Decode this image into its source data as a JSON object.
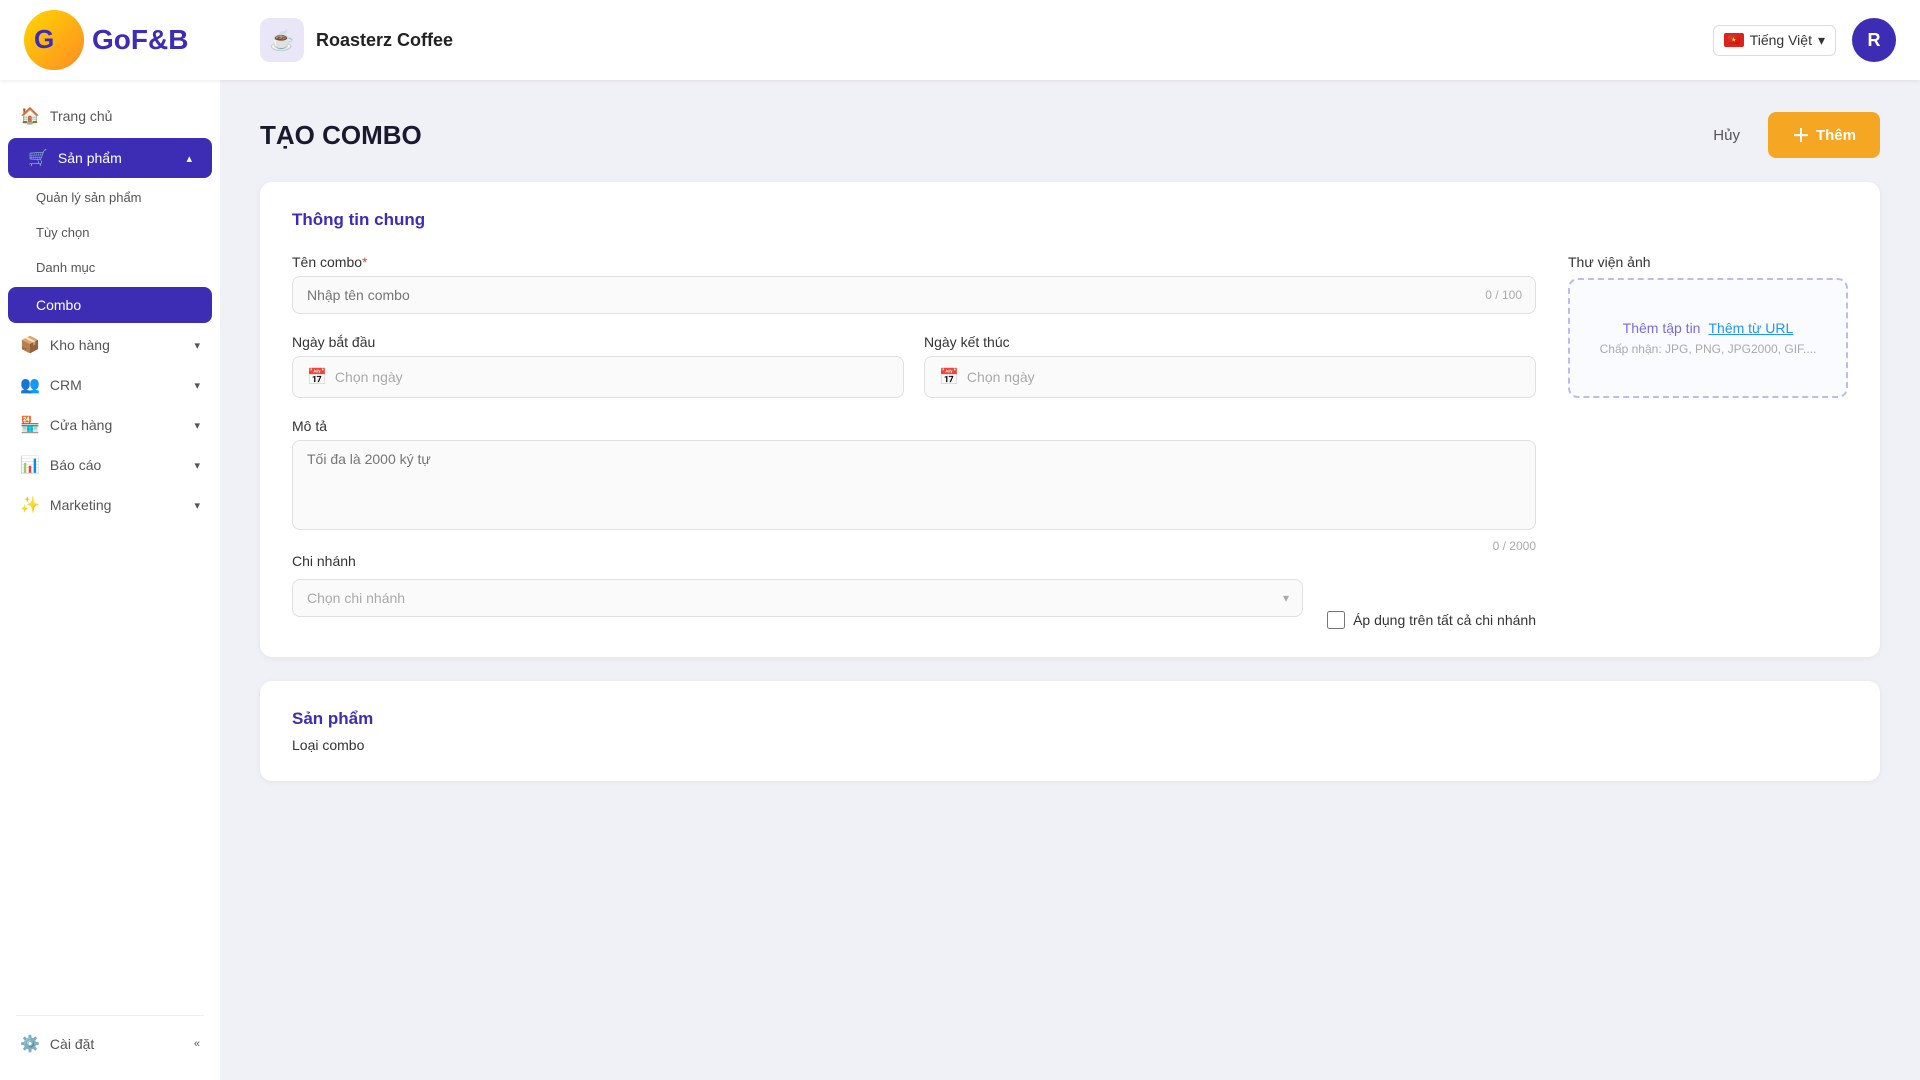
{
  "topbar": {
    "logo_text": "GoF&B",
    "brand_name": "Roasterz Coffee",
    "brand_icon": "☕",
    "lang": "Tiếng Việt",
    "avatar_letter": "R"
  },
  "sidebar": {
    "items": [
      {
        "id": "trang-chu",
        "label": "Trang chủ",
        "icon": "🏠",
        "active": false
      },
      {
        "id": "san-pham",
        "label": "Sản phẩm",
        "icon": "🛒",
        "active": true,
        "expanded": true,
        "children": [
          {
            "id": "quan-ly-san-pham",
            "label": "Quản lý sản phẩm",
            "active": false
          },
          {
            "id": "tuy-chon",
            "label": "Tùy chọn",
            "active": false
          },
          {
            "id": "danh-muc",
            "label": "Danh mục",
            "active": false
          },
          {
            "id": "combo",
            "label": "Combo",
            "active": true
          }
        ]
      },
      {
        "id": "kho-hang",
        "label": "Kho hàng",
        "icon": "📦",
        "active": false
      },
      {
        "id": "crm",
        "label": "CRM",
        "icon": "👥",
        "active": false
      },
      {
        "id": "cua-hang",
        "label": "Cửa hàng",
        "icon": "🏪",
        "active": false
      },
      {
        "id": "bao-cao",
        "label": "Báo cáo",
        "icon": "📊",
        "active": false
      },
      {
        "id": "marketing",
        "label": "Marketing",
        "icon": "✨",
        "active": false
      }
    ],
    "bottom": [
      {
        "id": "cai-dat",
        "label": "Cài đặt",
        "icon": "⚙️"
      }
    ],
    "collapse_label": "«"
  },
  "page": {
    "title": "TẠO COMBO",
    "cancel_label": "Hủy",
    "add_label": "Thêm",
    "sections": {
      "general": {
        "title": "Thông tin chung",
        "combo_name_label": "Tên combo",
        "combo_name_placeholder": "Nhập tên combo",
        "combo_name_counter": "0 / 100",
        "start_date_label": "Ngày bắt đầu",
        "start_date_placeholder": "Chọn ngày",
        "end_date_label": "Ngày kết thúc",
        "end_date_placeholder": "Chọn ngày",
        "description_label": "Mô tả",
        "description_placeholder": "Tối đa là 2000 ký tự",
        "description_counter": "0 / 2000",
        "image_library_label": "Thư viện ảnh",
        "upload_file_label": "Thêm tập tin",
        "upload_url_label": "Thêm từ URL",
        "upload_hint": "Chấp nhận: JPG, PNG, JPG2000, GIF....",
        "branch_label": "Chi nhánh",
        "branch_placeholder": "Chọn chi nhánh",
        "apply_all_label": "Áp dụng trên tất cả chi nhánh"
      },
      "products": {
        "title": "Sản phẩm",
        "combo_type_label": "Loại combo"
      }
    }
  }
}
